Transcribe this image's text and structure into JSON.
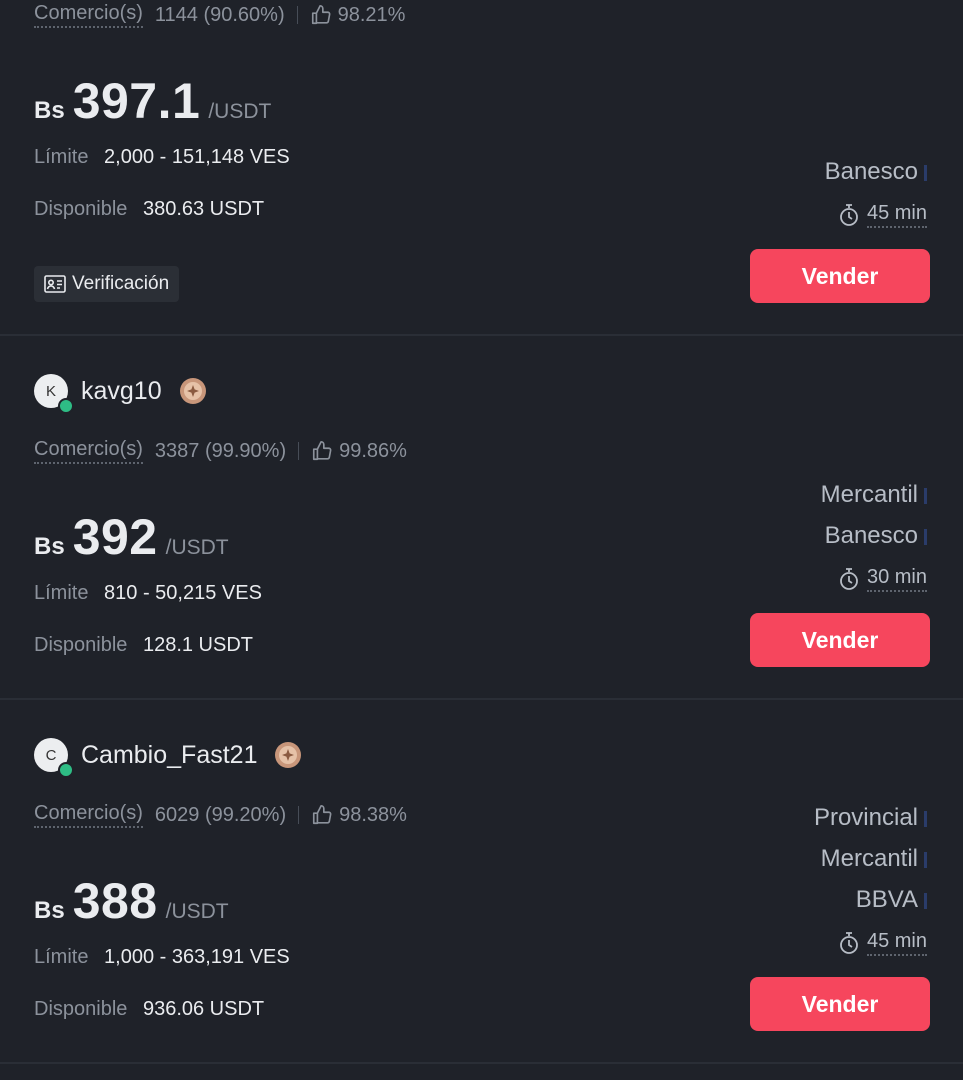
{
  "offers": [
    {
      "stats": {
        "comercio_label": "Comercio(s)",
        "trades": "1144 (90.60%)",
        "rating": "98.21%"
      },
      "price": {
        "currency": "Bs",
        "value": "397.1",
        "unit": "/USDT"
      },
      "limit": {
        "label": "Límite",
        "value": "2,000 - 151,148 VES"
      },
      "available": {
        "label": "Disponible",
        "value": "380.63 USDT"
      },
      "verification_label": "Verificación",
      "payment_methods": [
        "Banesco"
      ],
      "time": "45 min",
      "action_label": "Vender"
    },
    {
      "user": {
        "initial": "K",
        "name": "kavg10"
      },
      "stats": {
        "comercio_label": "Comercio(s)",
        "trades": "3387 (99.90%)",
        "rating": "99.86%"
      },
      "price": {
        "currency": "Bs",
        "value": "392",
        "unit": "/USDT"
      },
      "limit": {
        "label": "Límite",
        "value": "810 - 50,215 VES"
      },
      "available": {
        "label": "Disponible",
        "value": "128.1 USDT"
      },
      "payment_methods": [
        "Mercantil",
        "Banesco"
      ],
      "time": "30 min",
      "action_label": "Vender"
    },
    {
      "user": {
        "initial": "C",
        "name": "Cambio_Fast21"
      },
      "stats": {
        "comercio_label": "Comercio(s)",
        "trades": "6029 (99.20%)",
        "rating": "98.38%"
      },
      "price": {
        "currency": "Bs",
        "value": "388",
        "unit": "/USDT"
      },
      "limit": {
        "label": "Límite",
        "value": "1,000 - 363,191 VES"
      },
      "available": {
        "label": "Disponible",
        "value": "936.06 USDT"
      },
      "payment_methods": [
        "Provincial",
        "Mercantil",
        "BBVA"
      ],
      "time": "45 min",
      "action_label": "Vender"
    }
  ],
  "colors": {
    "background": "#1f2229",
    "sell": "#f6465d",
    "online": "#2ebd85",
    "badge": "#c8967a"
  },
  "icons": [
    "thumbs-up-icon",
    "stopwatch-icon",
    "id-card-icon",
    "merchant-badge-icon"
  ]
}
